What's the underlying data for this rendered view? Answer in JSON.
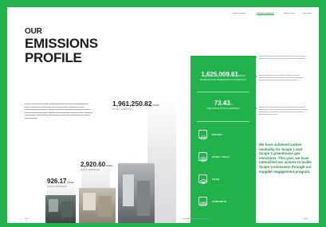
{
  "title": {
    "line1": "OUR",
    "line2": "EMISSIONS",
    "line3": "PROFILE"
  },
  "figures": {
    "scope1": {
      "value": "926.17",
      "unit": "tCO2e",
      "caption": "SCOPE 1 EMISSIONS"
    },
    "scope2": {
      "value": "2,920.60",
      "unit": "tCO2e",
      "caption": "SCOPE 2 EMISSIONS"
    },
    "scope3": {
      "value": "1,961,250.82",
      "unit": "tCO2e",
      "caption": "SCOPE 3 EMISSIONS"
    }
  },
  "panel": {
    "figure1": {
      "value": "1,625,009.61",
      "unit": "tCO2e",
      "caption": "EMISSIONS FROM TRANSPORTING OUR PRODUCTS"
    },
    "figure2": {
      "value": "73.43",
      "unit": "%",
      "caption": "PERCENTAGE OF TOTAL EMISSIONS"
    },
    "items": [
      {
        "label": "EXPORT"
      },
      {
        "label": "STEEL COILS"
      },
      {
        "label": "TILES"
      },
      {
        "label": "CONCRETE"
      }
    ]
  },
  "statement": "We have achieved carbon neutrality for Scope 1 and Scope 2 greenhouse gas emissions. This year, we have intensified our actions to tackle Scope 3 emissions through our supplier engagement program."
}
